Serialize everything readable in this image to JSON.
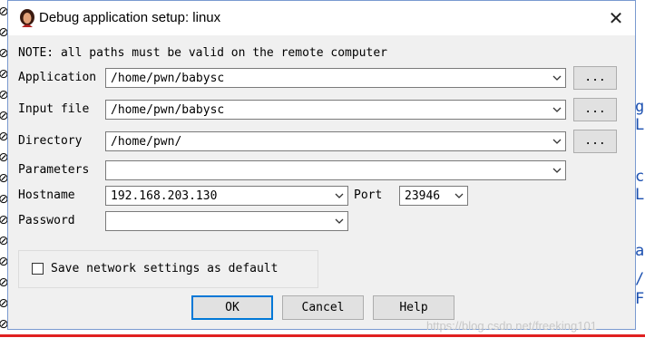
{
  "window": {
    "title": "Debug application setup: linux",
    "close_glyph": "✕"
  },
  "note": "NOTE: all paths must be valid on the remote computer",
  "fields": {
    "application": {
      "label": "Application",
      "value": "/home/pwn/babysc",
      "browse": "..."
    },
    "input_file": {
      "label": "Input file",
      "value": "/home/pwn/babysc",
      "browse": "..."
    },
    "directory": {
      "label": "Directory",
      "value": "/home/pwn/",
      "browse": "..."
    },
    "parameters": {
      "label": "Parameters",
      "value": ""
    },
    "hostname": {
      "label": "Hostname",
      "value": "192.168.203.130"
    },
    "port": {
      "label": "Port",
      "value": "23946"
    },
    "password": {
      "label": "Password",
      "value": ""
    }
  },
  "save_settings": {
    "label": "Save network settings as default",
    "checked": false
  },
  "buttons": {
    "ok": "OK",
    "cancel": "Cancel",
    "help": "Help"
  },
  "background": {
    "watermark": "https://blog.csdn.net/freeking101",
    "right_chars": [
      "g",
      "L",
      "c",
      "L",
      "a",
      "/",
      "F"
    ]
  },
  "colors": {
    "default_button_border": "#0078d7",
    "background_accent_line": "#e02020"
  }
}
